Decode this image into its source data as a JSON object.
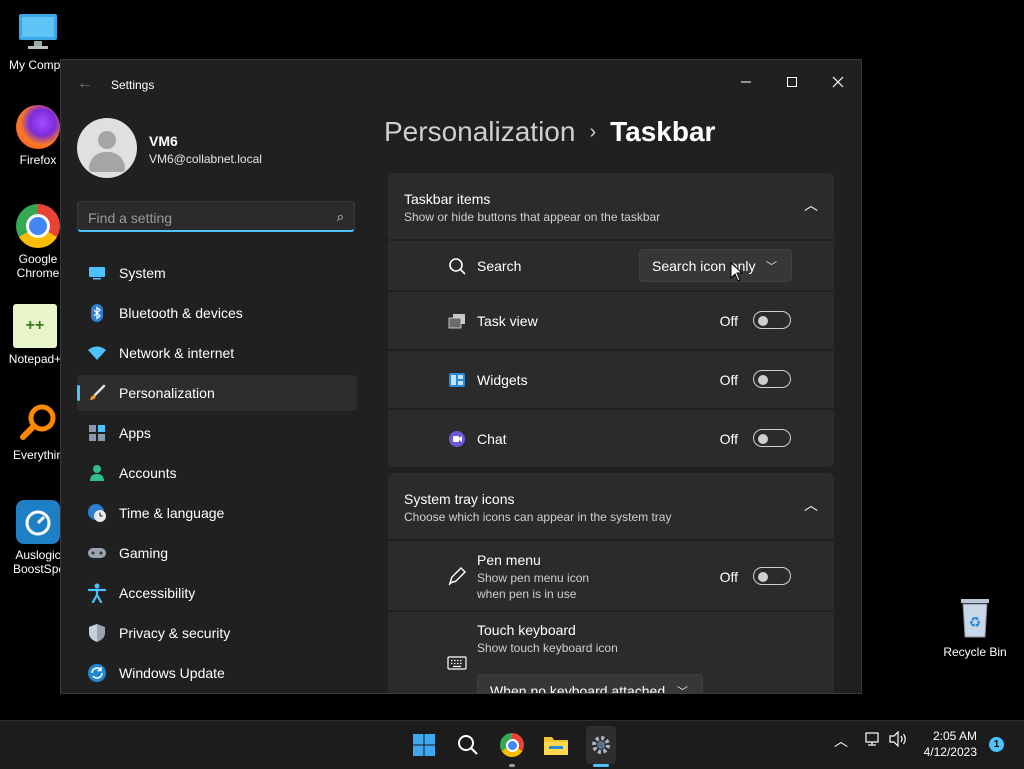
{
  "desktop": {
    "icons": [
      {
        "label": "My Compu",
        "icon": "monitor-icon"
      },
      {
        "label": "Firefox",
        "icon": "firefox-icon"
      },
      {
        "label": "Google Chrome",
        "icon": "chrome-icon"
      },
      {
        "label": "Notepad+",
        "icon": "notepad-plus-icon"
      },
      {
        "label": "Everythin",
        "icon": "everything-search-icon"
      },
      {
        "label": "Auslogic BoostSpe",
        "icon": "auslogics-icon"
      }
    ],
    "recycle_bin": "Recycle Bin"
  },
  "window": {
    "title": "Settings",
    "controls": {
      "minimize": "—",
      "maximize": "☐",
      "close": "✕"
    }
  },
  "profile": {
    "name": "VM6",
    "email": "VM6@collabnet.local"
  },
  "search": {
    "placeholder": "Find a setting"
  },
  "nav": [
    {
      "label": "System",
      "icon": "system-icon",
      "active": false
    },
    {
      "label": "Bluetooth & devices",
      "icon": "bluetooth-icon",
      "active": false
    },
    {
      "label": "Network & internet",
      "icon": "wifi-icon",
      "active": false
    },
    {
      "label": "Personalization",
      "icon": "brush-icon",
      "active": true
    },
    {
      "label": "Apps",
      "icon": "apps-icon",
      "active": false
    },
    {
      "label": "Accounts",
      "icon": "person-icon",
      "active": false
    },
    {
      "label": "Time & language",
      "icon": "globe-clock-icon",
      "active": false
    },
    {
      "label": "Gaming",
      "icon": "gamepad-icon",
      "active": false
    },
    {
      "label": "Accessibility",
      "icon": "accessibility-icon",
      "active": false
    },
    {
      "label": "Privacy & security",
      "icon": "shield-icon",
      "active": false
    },
    {
      "label": "Windows Update",
      "icon": "update-icon",
      "active": false
    }
  ],
  "breadcrumb": {
    "parent": "Personalization",
    "separator": "›",
    "current": "Taskbar"
  },
  "taskbar_items": {
    "title": "Taskbar items",
    "subtitle": "Show or hide buttons that appear on the taskbar",
    "search": {
      "label": "Search",
      "value": "Search icon only"
    },
    "task_view": {
      "label": "Task view",
      "state": "Off"
    },
    "widgets": {
      "label": "Widgets",
      "state": "Off"
    },
    "chat": {
      "label": "Chat",
      "state": "Off"
    }
  },
  "system_tray": {
    "title": "System tray icons",
    "subtitle": "Choose which icons can appear in the system tray",
    "pen_menu": {
      "label": "Pen menu",
      "desc1": "Show pen menu icon",
      "desc2": "when pen is in use",
      "state": "Off"
    },
    "touch_keyboard": {
      "label": "Touch keyboard",
      "desc": "Show touch keyboard icon",
      "value": "When no keyboard attached"
    }
  },
  "taskbar": {
    "time": "2:05 AM",
    "date": "4/12/2023",
    "notification_count": "1"
  },
  "colors": {
    "accent": "#4cc2ff",
    "window_bg": "#202020",
    "card_bg": "#2b2b2b"
  }
}
